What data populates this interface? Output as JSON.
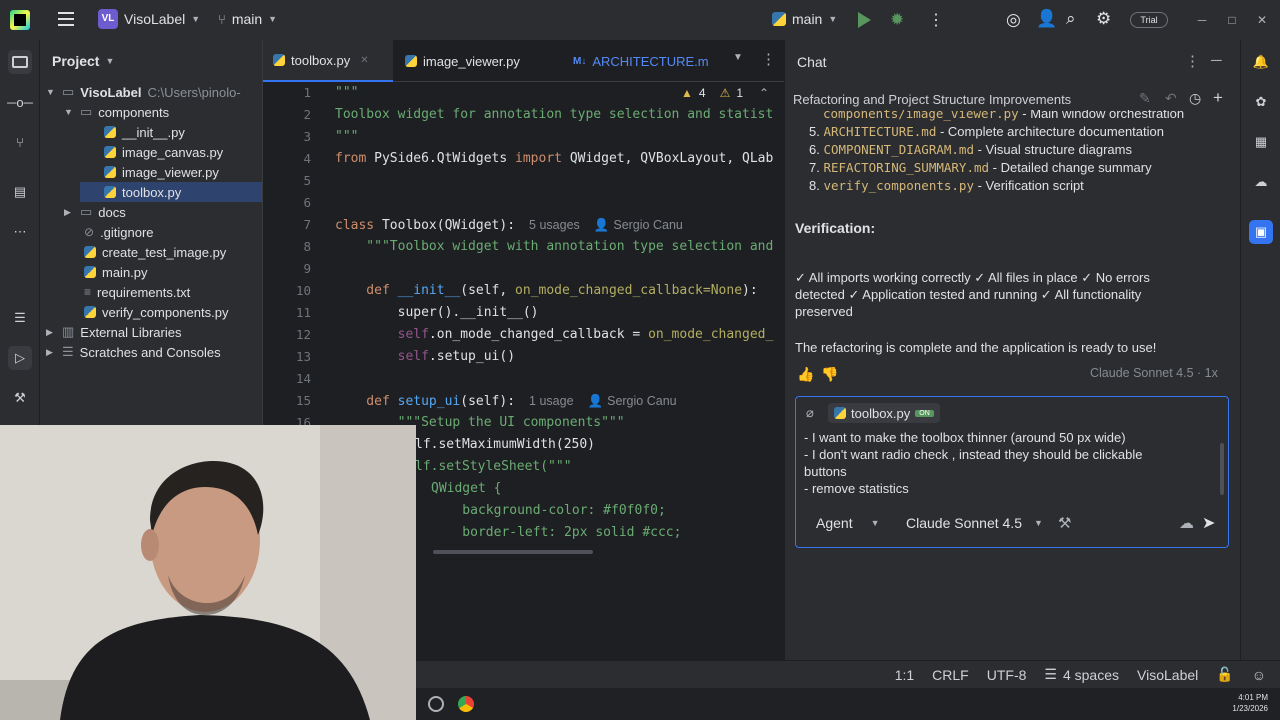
{
  "titlebar": {
    "project_badge": "VL",
    "project_name": "VisoLabel",
    "branch": "main",
    "run_config": "main",
    "trial_badge": "Trial"
  },
  "project_panel": {
    "title": "Project",
    "items": [
      {
        "label": "VisoLabel",
        "suffix": "C:\\Users\\pinolo-"
      },
      {
        "label": "components"
      },
      {
        "label": "__init__.py"
      },
      {
        "label": "image_canvas.py"
      },
      {
        "label": "image_viewer.py"
      },
      {
        "label": "toolbox.py"
      },
      {
        "label": "docs"
      },
      {
        "label": ".gitignore"
      },
      {
        "label": "create_test_image.py"
      },
      {
        "label": "main.py"
      },
      {
        "label": "requirements.txt"
      },
      {
        "label": "verify_components.py"
      },
      {
        "label": "External Libraries"
      },
      {
        "label": "Scratches and Consoles"
      }
    ]
  },
  "editor": {
    "tabs": [
      {
        "label": "toolbox.py"
      },
      {
        "label": "image_viewer.py"
      },
      {
        "label": "ARCHITECTURE.m"
      }
    ],
    "warnings": "4",
    "weak_warnings": "1",
    "line_numbers": [
      "1",
      "2",
      "3",
      "4",
      "5",
      "6",
      "7",
      "8",
      "9",
      "10",
      "11",
      "12",
      "13",
      "14",
      "15",
      "16"
    ],
    "code": {
      "l1": "\"\"\"",
      "l2": "Toolbox widget for annotation type selection and statist",
      "l3": "\"\"\"",
      "l4_kw": "from",
      "l4_rest": " PySide6.QtWidgets ",
      "l4_kw2": "import",
      "l4_tail": " QWidget, QVBoxLayout, QLab",
      "l7_kw": "class",
      "l7_name": " Toolbox",
      "l7_tail": "(QWidget):",
      "l7_hint": "5 usages",
      "l7_author": "Sergio Canu",
      "l8": "    \"\"\"Toolbox widget with annotation type selection and",
      "l10_kw": "    def",
      "l10_name": " __init__",
      "l10_tail": "(self, ",
      "l10_param": "on_mode_changed_callback=None",
      "l10_end": "):",
      "l11": "        super().__init__()",
      "l12_a": "        self",
      "l12_b": ".on_mode_changed_callback = ",
      "l12_c": "on_mode_changed_",
      "l13_a": "        self",
      "l13_b": ".setup_ui()",
      "l15_kw": "    def",
      "l15_name": " setup_ui",
      "l15_tail": "(self):",
      "l15_hint": "1 usage",
      "l15_author": "Sergio Canu",
      "l16": "        \"\"\"Setup the UI components\"\"\"",
      "l17": "lf.setMaximumWidth(250)",
      "l18": "lf.setStyleSheet(\"\"\"",
      "l19": "QWidget {",
      "l20": "    background-color: #f0f0f0;",
      "l21": "    border-left: 2px solid #ccc;"
    }
  },
  "chat": {
    "title": "Chat",
    "conversation_title": "Refactoring and Project Structure Improvements",
    "list_items": [
      {
        "num": "",
        "file": "components/image_viewer.py",
        "desc": " - Main window orchestration"
      },
      {
        "num": "5.",
        "file": "ARCHITECTURE.md",
        "desc": " - Complete architecture documentation"
      },
      {
        "num": "6.",
        "file": "COMPONENT_DIAGRAM.md",
        "desc": " - Visual structure diagrams"
      },
      {
        "num": "7.",
        "file": "REFACTORING_SUMMARY.md",
        "desc": " - Detailed change summary"
      },
      {
        "num": "8.",
        "file": "verify_components.py",
        "desc": " - Verification script"
      }
    ],
    "verification_heading": "Verification:",
    "verification_text_1": "✓ All imports working correctly ✓ All files in place ✓ No errors",
    "verification_text_2": "detected ✓ Application tested and running ✓ All functionality",
    "verification_text_3": "preserved",
    "conclusion": "The refactoring is complete and the application is ready to use!",
    "model_info": "Claude Sonnet 4.5 · 1x",
    "input": {
      "attachment": "toolbox.py",
      "attachment_badge": "ON",
      "line1": "- I want to make the toolbox thinner (around 50 px wide)",
      "line2": "- I don't want radio check , instead they should be clickable",
      "line3": "buttons",
      "line4": "- remove statistics"
    },
    "mode": "Agent",
    "model": "Claude Sonnet 4.5"
  },
  "statusbar": {
    "position": "1:1",
    "line_ending": "CRLF",
    "encoding": "UTF-8",
    "indent": "4 spaces",
    "project": "VisoLabel"
  },
  "taskbar": {
    "time": "4:01 PM",
    "date": "1/23/2026"
  }
}
